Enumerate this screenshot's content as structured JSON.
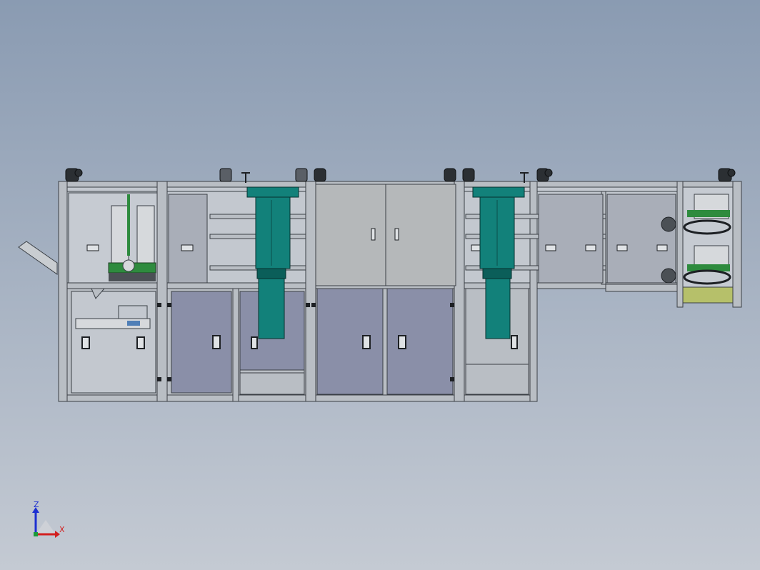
{
  "viewport": {
    "background_top": "#8a9bb2",
    "background_bottom": "#c4cad3"
  },
  "colors": {
    "frame": "#b9bec4",
    "frame_dark": "#3a3f45",
    "panel": "#a9aeb8",
    "panel_door": "#8a8fa8",
    "cabinet": "#b5b8ba",
    "actuator": "#12817a",
    "actuator_dark": "#0b5e59",
    "guard": "#c3c8cf",
    "accent_green": "#2e8b3e",
    "accent_yellow": "#b6c06a",
    "chute": "#c9cdd1"
  },
  "triad": {
    "z_label": "Z",
    "x_label": "X",
    "z_color": "#1c2fd1",
    "x_color": "#d21f1f",
    "y_color": "#1b9a3a"
  }
}
